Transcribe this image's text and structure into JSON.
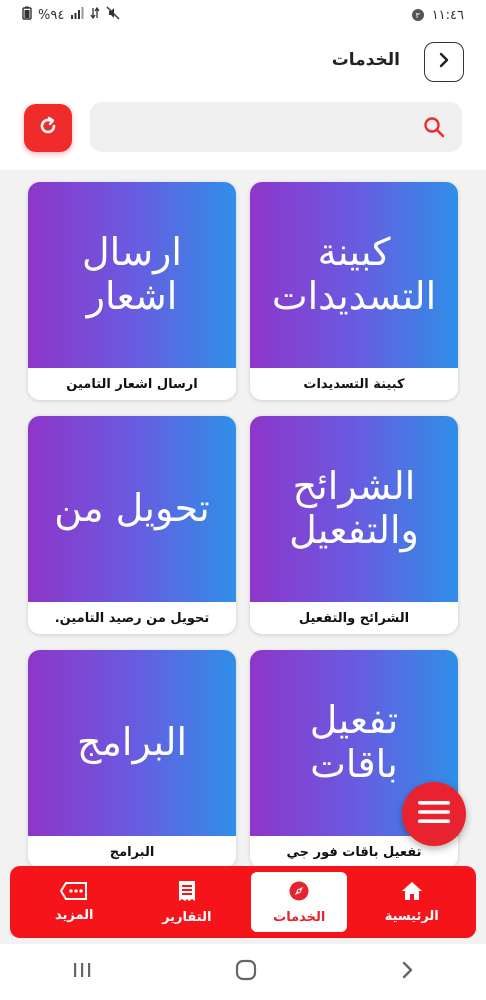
{
  "status_bar": {
    "time": "١١:٤٦",
    "notification_count": "٣",
    "battery": "%٩٤"
  },
  "header": {
    "title": "الخدمات"
  },
  "search": {
    "placeholder": ""
  },
  "cards": [
    {
      "image_text": "كبينة التسديدات",
      "label": "كبينة التسديدات"
    },
    {
      "image_text": "ارسال اشعار",
      "label": "ارسال اشعار التامين"
    },
    {
      "image_text": "الشرائح والتفعيل",
      "label": "الشرائح والتفعيل"
    },
    {
      "image_text": "تحويل من",
      "label": "تحويل من رصيد التامين."
    },
    {
      "image_text": "تفعيل باقات",
      "label": "تفعيل باقات فور جي"
    },
    {
      "image_text": "البرامج",
      "label": "البرامج"
    }
  ],
  "bottom_nav": [
    {
      "label": "الرئيسية",
      "icon": "home-icon"
    },
    {
      "label": "الخدمات",
      "icon": "compass-icon",
      "active": true
    },
    {
      "label": "التقارير",
      "icon": "receipt-icon"
    },
    {
      "label": "المزيد",
      "icon": "more-icon"
    }
  ],
  "colors": {
    "accent_red": "#ef2b2b",
    "gradient_start": "#8e36c9",
    "gradient_end": "#2f8fe8"
  }
}
